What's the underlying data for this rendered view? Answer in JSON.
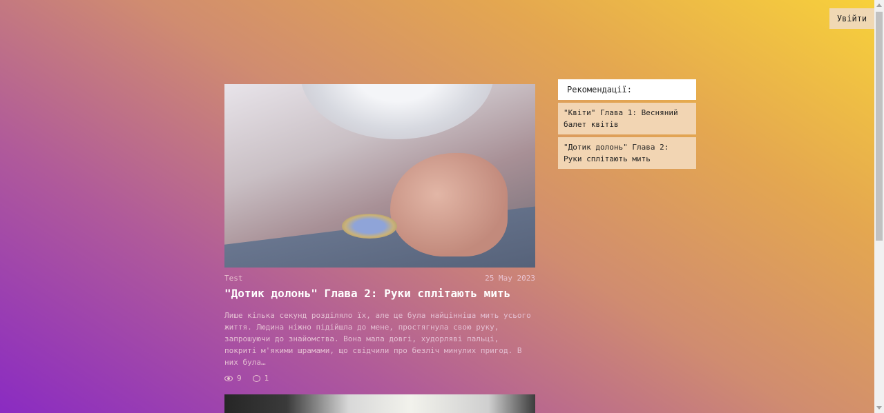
{
  "header": {
    "login_label": "Увійти"
  },
  "article": {
    "author": "Test",
    "date": "25 May 2023",
    "title": "\"Дотик долонь\" Глава 2: Руки сплітають мить",
    "excerpt": "Лише кілька секунд розділяло їх, але це була найцінніша мить усього життя. Людина ніжно підійшла до мене, простягнула свою руку, запрошуючи до знайомства. Вона мала довгі, худорляві пальці, покриті м'якими шрамами, що свідчили про безліч минулих пригод. В них була…",
    "views": "9",
    "comments": "1",
    "icons": {
      "views": "eye-icon",
      "comments": "comment-icon"
    }
  },
  "recommendations": {
    "heading": "Рекомендації:",
    "items": [
      {
        "label": "\"Квіти\" Глава 1: Весняний балет квітів"
      },
      {
        "label": "\"Дотик долонь\" Глава 2: Руки сплітають мить"
      }
    ]
  }
}
